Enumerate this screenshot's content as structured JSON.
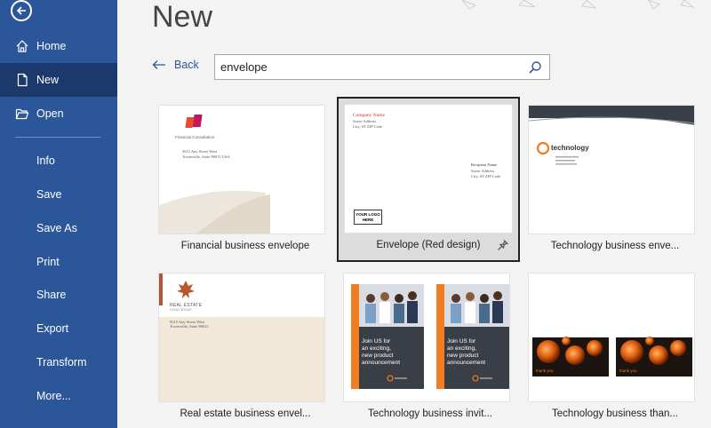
{
  "sidebar": {
    "items": [
      {
        "label": "Home"
      },
      {
        "label": "New"
      },
      {
        "label": "Open"
      },
      {
        "label": "Info"
      },
      {
        "label": "Save"
      },
      {
        "label": "Save As"
      },
      {
        "label": "Print"
      },
      {
        "label": "Share"
      },
      {
        "label": "Export"
      },
      {
        "label": "Transform"
      },
      {
        "label": "More..."
      }
    ],
    "accent": "#2b579a",
    "active_bg": "#1b3a6b"
  },
  "main": {
    "title": "New",
    "back_label": "Back",
    "search_value": "envelope",
    "templates": [
      {
        "label": "Financial business envelope",
        "preview": {
          "company": "Financial Consultation",
          "address1": "5615 Any Street West",
          "address2": "Townsville, State 98013 USA"
        }
      },
      {
        "label": "Envelope (Red design)",
        "preview": {
          "company": "Company Name",
          "street": "Street Address",
          "city": "City, ST ZIP Code",
          "recipient": "Recipient Name",
          "r_street": "Street Address",
          "r_city": "City, ST ZIP Code",
          "logo1": "YOUR LOGO",
          "logo2": "HERE"
        }
      },
      {
        "label": "Technology business enve...",
        "preview": {
          "brand": "technology"
        }
      },
      {
        "label": "Real estate business envel...",
        "preview": {
          "brand1": "REAL ESTATE",
          "brand2": "GOOD GROUP",
          "address1": "5615 Any Street West",
          "address2": "Townsville, State 98013"
        }
      },
      {
        "label": "Technology business invit...",
        "preview": {
          "text1": "Join US for",
          "text2": "an exciting,",
          "text3": "new product",
          "text4": "announcement",
          "text5": "Join US for",
          "text6": "an exciting,",
          "text7": "new product",
          "text8": "announcement"
        }
      },
      {
        "label": "Technology business than...",
        "preview": {
          "thanks1": "thank you",
          "thanks2": "thank you"
        }
      }
    ]
  }
}
